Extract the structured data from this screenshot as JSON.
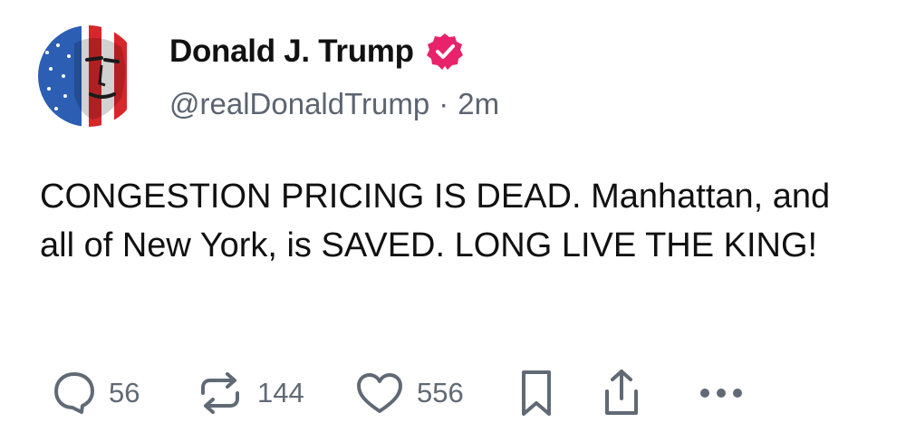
{
  "author": {
    "display_name": "Donald J. Trump",
    "verified_icon": "verified-badge-icon",
    "handle": "@realDonaldTrump",
    "separator": "·",
    "time_ago": "2m"
  },
  "post": {
    "text": "CONGESTION PRICING IS DEAD. Manhattan, and all of New York, is SAVED. LONG LIVE THE KING!"
  },
  "actions": {
    "reply_count": "56",
    "repost_count": "144",
    "like_count": "556"
  },
  "colors": {
    "badge": "#e8236b",
    "icon_gray": "#606a75",
    "text": "#111111",
    "secondary_text": "#5b6470"
  }
}
